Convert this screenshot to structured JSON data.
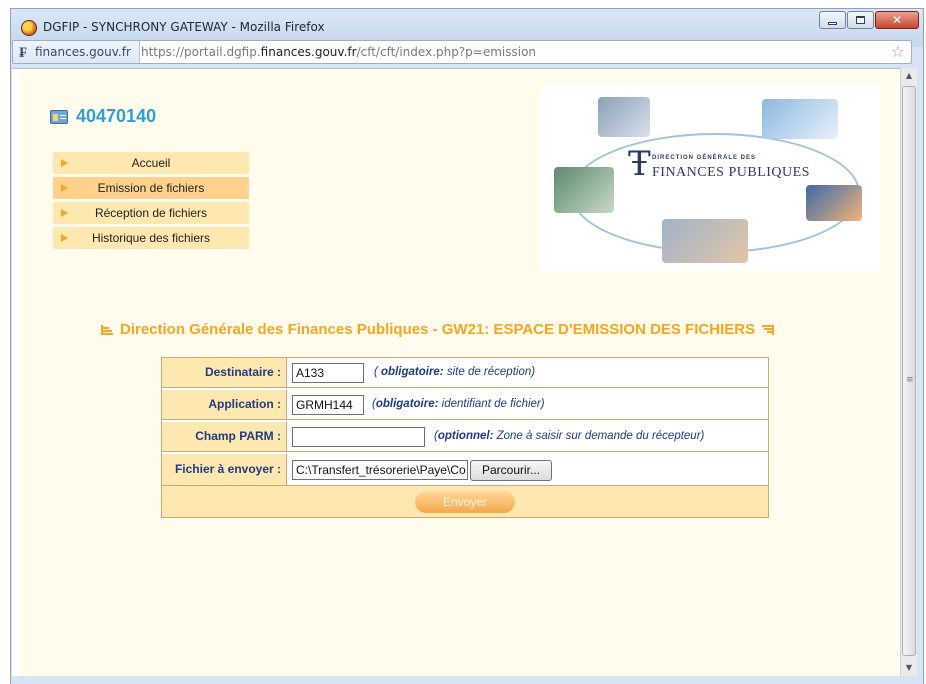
{
  "window": {
    "title": "DGFIP - SYNCHRONY GATEWAY - Mozilla Firefox"
  },
  "address": {
    "site_badge": "finances.gouv.fr",
    "url_prefix": "https://portail.dgfip.",
    "url_domain": "finances.gouv.fr",
    "url_path": "/cft/cft/index.php?p=emission"
  },
  "site": {
    "code": "40470140"
  },
  "menu": {
    "items": [
      {
        "label": "Accueil"
      },
      {
        "label": "Emission de fichiers"
      },
      {
        "label": "Réception de fichiers"
      },
      {
        "label": "Historique des fichiers"
      }
    ],
    "active_index": 1
  },
  "banner": {
    "logo_line1": "DIRECTION GÉNÉRALE DES",
    "logo_line2": "FINANCES PUBLIQUES"
  },
  "section": {
    "title": "Direction Générale des Finances Publiques - GW21: ESPACE D'EMISSION DES FICHIERS"
  },
  "form": {
    "destinataire": {
      "label": "Destinataire :",
      "value": "A133",
      "hint_strong": "obligatoire:",
      "hint_rest": " site de réception)",
      "hint_open": "( "
    },
    "application": {
      "label": "Application :",
      "value": "GRMH144",
      "hint_open": "(",
      "hint_strong": "obligatoire:",
      "hint_rest": " identifiant de fichier)"
    },
    "champ_parm": {
      "label": "Champ PARM :",
      "value": "",
      "hint_open": "(",
      "hint_strong": "optionnel:",
      "hint_rest": " Zone à saisir sur demande du récepteur)"
    },
    "fichier": {
      "label": "Fichier à envoyer :",
      "value": "C:\\Transfert_trésorerie\\Paye\\Co",
      "browse_label": "Parcourir..."
    },
    "submit_label": "Envoyer"
  },
  "colors": {
    "accent": "#f5a623",
    "label_text": "#1f3b84",
    "label_bg": "#ffe8b0",
    "site_code": "#2ca0d8"
  }
}
